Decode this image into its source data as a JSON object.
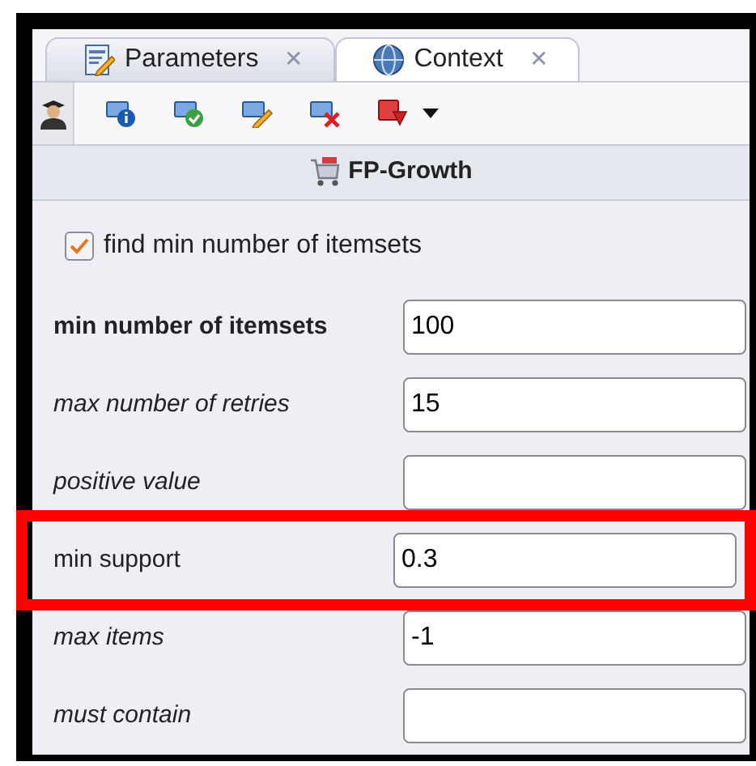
{
  "tabs": [
    {
      "label": "Parameters",
      "kind": "parameters",
      "close": "✕",
      "selected": true
    },
    {
      "label": "Context",
      "kind": "context",
      "close": "✕",
      "selected": false
    }
  ],
  "toolbar": [
    {
      "kind": "expert",
      "selected": true
    },
    {
      "kind": "info",
      "selected": false
    },
    {
      "kind": "check",
      "selected": false
    },
    {
      "kind": "edit",
      "selected": false
    },
    {
      "kind": "delete",
      "selected": false
    },
    {
      "kind": "export",
      "selected": false
    },
    {
      "kind": "dropdown",
      "selected": false
    }
  ],
  "operator": {
    "title": "FP-Growth"
  },
  "checkbox": {
    "label": "find min number of itemsets",
    "checked": true
  },
  "parameters": [
    {
      "label": "min number of itemsets",
      "kind": "mandatory",
      "value": "100",
      "highlighted": false
    },
    {
      "label": "max number of retries",
      "kind": "optional",
      "value": "15",
      "highlighted": false
    },
    {
      "label": "positive value",
      "kind": "optional",
      "highlighted": false
    },
    {
      "label": "min support",
      "kind": "plain",
      "value": "0.3",
      "highlighted": true
    },
    {
      "label": "max items",
      "kind": "optional",
      "value": "-1",
      "highlighted": false
    },
    {
      "label": "must contain",
      "kind": "optional",
      "highlighted": false
    }
  ]
}
